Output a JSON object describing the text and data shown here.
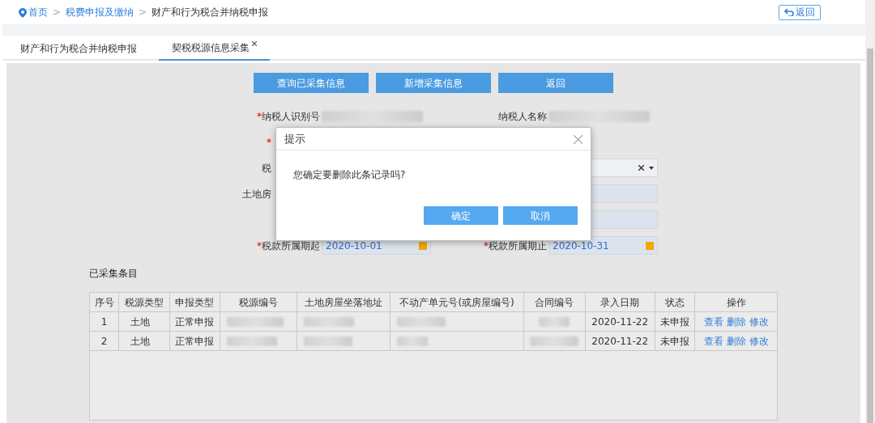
{
  "breadcrumb": [
    {
      "kind": "link",
      "label": "首页"
    },
    {
      "kind": "separator",
      "label": ">"
    },
    {
      "kind": "link",
      "label": "税费申报及缴纳"
    },
    {
      "kind": "separator",
      "label": ">"
    },
    {
      "kind": "current",
      "label": "财产和行为税合并纳税申报"
    }
  ],
  "back_button": {
    "label": "返回"
  },
  "tabs": [
    {
      "label": "财产和行为税合并纳税申报",
      "selected": false,
      "closable": false
    },
    {
      "label": "契税税源信息采集",
      "selected": true,
      "closable": true
    }
  ],
  "actions": [
    "查询已采集信息",
    "新增采集信息",
    "返回"
  ],
  "form_rows": [
    {
      "left": {
        "mark": "*",
        "label": "纳税人识别号",
        "kind": "redacted"
      },
      "right": {
        "label": "纳税人名称",
        "kind": "redacted"
      }
    },
    {
      "left": {
        "mark": "*",
        "kind": "covered"
      },
      "right": {
        "kind": "covered"
      }
    },
    {
      "left": {
        "label": "税",
        "kind": "covered"
      },
      "right": {
        "kind": "select"
      }
    },
    {
      "left": {
        "label": "土地房",
        "kind": "covered"
      },
      "right": {
        "kind": "text"
      }
    },
    {
      "left": {
        "kind": "covered"
      },
      "right": {
        "kind": "text"
      }
    },
    {
      "left": {
        "mark": "*",
        "label": "税款所属期起",
        "kind": "date",
        "value": "2020-10-01"
      },
      "right": {
        "mark": "*",
        "label": "税款所属期止",
        "kind": "date",
        "value": "2020-10-31"
      }
    }
  ],
  "section_title": "已采集条目",
  "table": {
    "columns": [
      "序号",
      "税源类型",
      "申报类型",
      "税源编号",
      "土地房屋坐落地址",
      "不动产单元号(或房屋编号)",
      "合同编号",
      "录入日期",
      "状态",
      "操作"
    ],
    "rows": [
      {
        "cells": [
          {
            "text": "1"
          },
          {
            "text": "土地"
          },
          {
            "text": "正常申报"
          },
          {
            "kind": "redacted"
          },
          {
            "kind": "redacted"
          },
          {
            "kind": "redacted"
          },
          {
            "kind": "redacted"
          },
          {
            "text": "2020-11-22"
          },
          {
            "text": "未申报"
          }
        ],
        "actions": [
          "查看",
          "删除",
          "修改"
        ]
      },
      {
        "cells": [
          {
            "text": "2"
          },
          {
            "text": "土地"
          },
          {
            "text": "正常申报"
          },
          {
            "kind": "redacted"
          },
          {
            "kind": "redacted"
          },
          {
            "kind": "redacted"
          },
          {
            "kind": "redacted"
          },
          {
            "text": "2020-11-22"
          },
          {
            "text": "未申报"
          }
        ],
        "actions": [
          "查看",
          "删除",
          "修改"
        ]
      }
    ]
  },
  "dialog": {
    "title": "提示",
    "message": "您确定要删除此条记录吗?",
    "buttons": [
      "确定",
      "取消"
    ]
  }
}
